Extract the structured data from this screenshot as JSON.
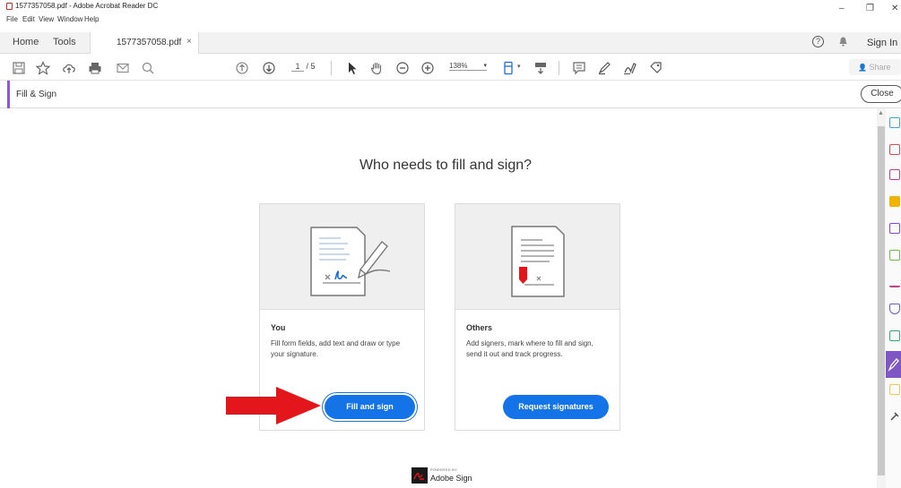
{
  "window": {
    "title": "1577357058.pdf - Adobe Acrobat Reader DC",
    "minimize": "–",
    "restore": "❐",
    "close": "✕"
  },
  "menu": [
    "File",
    "Edit",
    "View",
    "Window",
    "Help"
  ],
  "tabs": {
    "home": "Home",
    "tools": "Tools",
    "document": "1577357058.pdf",
    "document_close": "×"
  },
  "header": {
    "help": "?",
    "sign_in": "Sign In"
  },
  "toolbar": {
    "page_current": "1",
    "page_total": "/ 5",
    "zoom": "138%",
    "share": "Share"
  },
  "fill_sign": {
    "label": "Fill & Sign",
    "close": "Close",
    "accent_color": "#9254de"
  },
  "main": {
    "heading": "Who needs to fill and sign?",
    "cards": [
      {
        "title": "You",
        "description": "Fill form fields, add text and draw or type your signature.",
        "button": "Fill and sign"
      },
      {
        "title": "Others",
        "description": "Add signers, mark where to fill and sign, send it out and track progress.",
        "button": "Request signatures"
      }
    ],
    "button_color": "#1473e6",
    "arrow_color": "#e3161c"
  },
  "powered": {
    "small": "POWERED BY",
    "brand": "Adobe Sign"
  },
  "right_panel_icons": [
    "export-pdf-icon",
    "create-pdf-icon",
    "organize-pages-icon",
    "comment-icon",
    "combine-files-icon",
    "edit-pdf-icon",
    "sign-icon",
    "protect-icon",
    "compress-icon",
    "fill-sign-icon",
    "send-review-icon",
    "more-tools-icon"
  ]
}
